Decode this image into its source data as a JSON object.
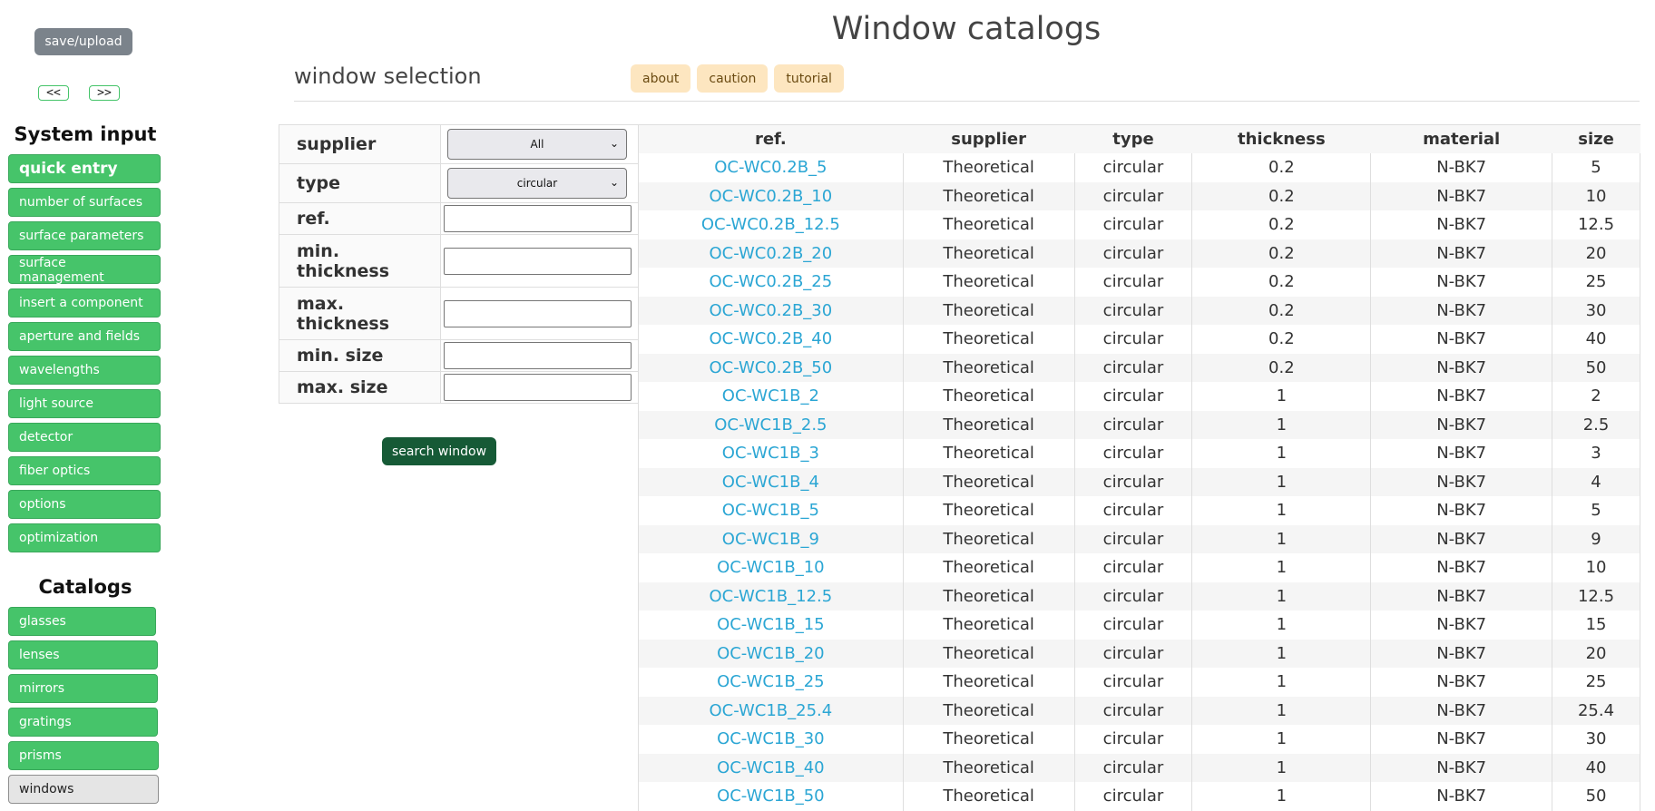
{
  "sidebar": {
    "save_label": "save/upload",
    "prev_label": "<<",
    "next_label": ">>",
    "system_heading": "System input",
    "system_items": [
      "quick entry",
      "number of surfaces",
      "surface parameters",
      "surface management",
      "insert a component",
      "aperture and fields",
      "wavelengths",
      "light source",
      "detector",
      "fiber optics",
      "options",
      "optimization"
    ],
    "catalogs_heading": "Catalogs",
    "catalog_items": [
      "glasses",
      "lenses",
      "mirrors",
      "gratings",
      "prisms",
      "windows"
    ]
  },
  "header": {
    "title": "Window catalogs",
    "section": "window selection",
    "tabs": [
      "about",
      "caution",
      "tutorial"
    ]
  },
  "filter": {
    "supplier_label": "supplier",
    "supplier_value": "All",
    "type_label": "type",
    "type_value": "circular",
    "ref_label": "ref.",
    "min_thickness_label": "min. thickness",
    "max_thickness_label": "max. thickness",
    "min_size_label": "min. size",
    "max_size_label": "max. size",
    "search_label": "search window"
  },
  "results": {
    "columns": [
      "ref.",
      "supplier",
      "type",
      "thickness",
      "material",
      "size"
    ],
    "rows": [
      [
        "OC-WC0.2B_5",
        "Theoretical",
        "circular",
        "0.2",
        "N-BK7",
        "5"
      ],
      [
        "OC-WC0.2B_10",
        "Theoretical",
        "circular",
        "0.2",
        "N-BK7",
        "10"
      ],
      [
        "OC-WC0.2B_12.5",
        "Theoretical",
        "circular",
        "0.2",
        "N-BK7",
        "12.5"
      ],
      [
        "OC-WC0.2B_20",
        "Theoretical",
        "circular",
        "0.2",
        "N-BK7",
        "20"
      ],
      [
        "OC-WC0.2B_25",
        "Theoretical",
        "circular",
        "0.2",
        "N-BK7",
        "25"
      ],
      [
        "OC-WC0.2B_30",
        "Theoretical",
        "circular",
        "0.2",
        "N-BK7",
        "30"
      ],
      [
        "OC-WC0.2B_40",
        "Theoretical",
        "circular",
        "0.2",
        "N-BK7",
        "40"
      ],
      [
        "OC-WC0.2B_50",
        "Theoretical",
        "circular",
        "0.2",
        "N-BK7",
        "50"
      ],
      [
        "OC-WC1B_2",
        "Theoretical",
        "circular",
        "1",
        "N-BK7",
        "2"
      ],
      [
        "OC-WC1B_2.5",
        "Theoretical",
        "circular",
        "1",
        "N-BK7",
        "2.5"
      ],
      [
        "OC-WC1B_3",
        "Theoretical",
        "circular",
        "1",
        "N-BK7",
        "3"
      ],
      [
        "OC-WC1B_4",
        "Theoretical",
        "circular",
        "1",
        "N-BK7",
        "4"
      ],
      [
        "OC-WC1B_5",
        "Theoretical",
        "circular",
        "1",
        "N-BK7",
        "5"
      ],
      [
        "OC-WC1B_9",
        "Theoretical",
        "circular",
        "1",
        "N-BK7",
        "9"
      ],
      [
        "OC-WC1B_10",
        "Theoretical",
        "circular",
        "1",
        "N-BK7",
        "10"
      ],
      [
        "OC-WC1B_12.5",
        "Theoretical",
        "circular",
        "1",
        "N-BK7",
        "12.5"
      ],
      [
        "OC-WC1B_15",
        "Theoretical",
        "circular",
        "1",
        "N-BK7",
        "15"
      ],
      [
        "OC-WC1B_20",
        "Theoretical",
        "circular",
        "1",
        "N-BK7",
        "20"
      ],
      [
        "OC-WC1B_25",
        "Theoretical",
        "circular",
        "1",
        "N-BK7",
        "25"
      ],
      [
        "OC-WC1B_25.4",
        "Theoretical",
        "circular",
        "1",
        "N-BK7",
        "25.4"
      ],
      [
        "OC-WC1B_30",
        "Theoretical",
        "circular",
        "1",
        "N-BK7",
        "30"
      ],
      [
        "OC-WC1B_40",
        "Theoretical",
        "circular",
        "1",
        "N-BK7",
        "40"
      ],
      [
        "OC-WC1B_50",
        "Theoretical",
        "circular",
        "1",
        "N-BK7",
        "50"
      ]
    ]
  },
  "icons": {
    "select_chevron": "chevron-down-icon"
  },
  "colors": {
    "nav_green": "#46c46a",
    "tab_peach": "#fde6c0",
    "search_green": "#165a36",
    "link_blue": "#2ba6d4"
  }
}
